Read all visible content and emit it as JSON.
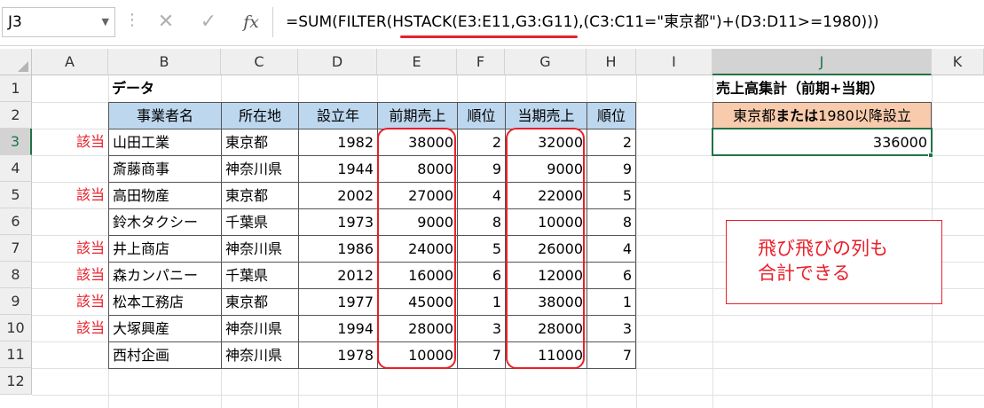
{
  "formula_bar": {
    "name_box": "J3",
    "cancel_icon": "✕",
    "enter_icon": "✓",
    "fx_label": "fx",
    "formula": "=SUM(FILTER(HSTACK(E3:E11,G3:G11),(C3:C11=\"東京都\")+(D3:D11>=1980)))"
  },
  "columns": [
    "A",
    "B",
    "C",
    "D",
    "E",
    "F",
    "G",
    "H",
    "I",
    "J",
    "K"
  ],
  "rows": [
    "1",
    "2",
    "3",
    "4",
    "5",
    "6",
    "7",
    "8",
    "9",
    "10",
    "11",
    "12"
  ],
  "sheet": {
    "title": "データ",
    "headers": [
      "事業者名",
      "所在地",
      "設立年",
      "前期売上",
      "順位",
      "当期売上",
      "順位"
    ],
    "records": [
      {
        "flag": "該当",
        "name": "山田工業",
        "loc": "東京都",
        "year": "1982",
        "prev": "38000",
        "rank1": "2",
        "curr": "32000",
        "rank2": "2"
      },
      {
        "flag": "",
        "name": "斎藤商事",
        "loc": "神奈川県",
        "year": "1944",
        "prev": "8000",
        "rank1": "9",
        "curr": "9000",
        "rank2": "9"
      },
      {
        "flag": "該当",
        "name": "高田物産",
        "loc": "東京都",
        "year": "2002",
        "prev": "27000",
        "rank1": "4",
        "curr": "22000",
        "rank2": "5"
      },
      {
        "flag": "",
        "name": "鈴木タクシー",
        "loc": "千葉県",
        "year": "1973",
        "prev": "9000",
        "rank1": "8",
        "curr": "10000",
        "rank2": "8"
      },
      {
        "flag": "該当",
        "name": "井上商店",
        "loc": "神奈川県",
        "year": "1986",
        "prev": "24000",
        "rank1": "5",
        "curr": "26000",
        "rank2": "4"
      },
      {
        "flag": "該当",
        "name": "森カンパニー",
        "loc": "千葉県",
        "year": "2012",
        "prev": "16000",
        "rank1": "6",
        "curr": "12000",
        "rank2": "6"
      },
      {
        "flag": "該当",
        "name": "松本工務店",
        "loc": "東京都",
        "year": "1977",
        "prev": "45000",
        "rank1": "1",
        "curr": "38000",
        "rank2": "1"
      },
      {
        "flag": "該当",
        "name": "大塚興産",
        "loc": "神奈川県",
        "year": "1994",
        "prev": "28000",
        "rank1": "3",
        "curr": "28000",
        "rank2": "3"
      },
      {
        "flag": "",
        "name": "西村企画",
        "loc": "神奈川県",
        "year": "1978",
        "prev": "10000",
        "rank1": "7",
        "curr": "11000",
        "rank2": "7"
      }
    ]
  },
  "summary": {
    "title": "売上高集計（前期+当期）",
    "cond_a": "東京都",
    "cond_b": "または",
    "cond_c": "1980以降設立",
    "result": "336000"
  },
  "note": {
    "line1": "飛び飛びの列も",
    "line2": "合計できる"
  },
  "colors": {
    "accent_red": "#e8202a",
    "header_blue": "#bdd7ee",
    "condition_orange": "#f8cbad",
    "selection_green": "#217346"
  }
}
